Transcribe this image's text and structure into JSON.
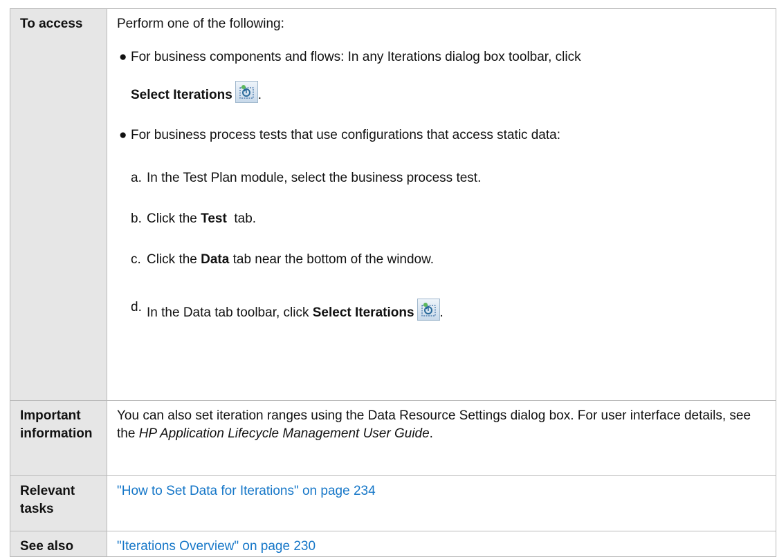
{
  "rows": {
    "access": {
      "header": "To access",
      "intro": "Perform one of the following:",
      "bullet1": {
        "text": "For business components and flows: In any Iterations dialog box toolbar, click",
        "button_label": "Select Iterations",
        "icon": "select-iterations-icon",
        "end": "."
      },
      "bullet2": {
        "text": "For business process tests that use configurations that access static data:",
        "steps": {
          "a": {
            "letter": "a.",
            "text": "In the Test Plan module, select the business process test."
          },
          "b": {
            "letter": "b.",
            "pre": "Click the ",
            "bold": "Test",
            "post": "  tab."
          },
          "c": {
            "letter": "c.",
            "pre": "Click the ",
            "bold": "Data",
            "post": " tab near the bottom of the window."
          },
          "d": {
            "letter": "d.",
            "pre": "In the Data tab toolbar, click ",
            "bold": "Select Iterations",
            "end": "."
          }
        }
      }
    },
    "important": {
      "header": "Important information",
      "line1": "You can also set iteration ranges using the Data Resource Settings dialog box. For user interface details, see the ",
      "guide": "HP Application Lifecycle Management User Guide",
      "end": "."
    },
    "tasks": {
      "header": "Relevant tasks",
      "link": "\"How to Set Data for Iterations\" on page 234"
    },
    "see_also": {
      "header": "See also",
      "link": "\"Iterations Overview\" on page 230"
    }
  },
  "colors": {
    "header_bg": "#e6e6e6",
    "border": "#b9b9b9",
    "link": "#1677c8"
  }
}
